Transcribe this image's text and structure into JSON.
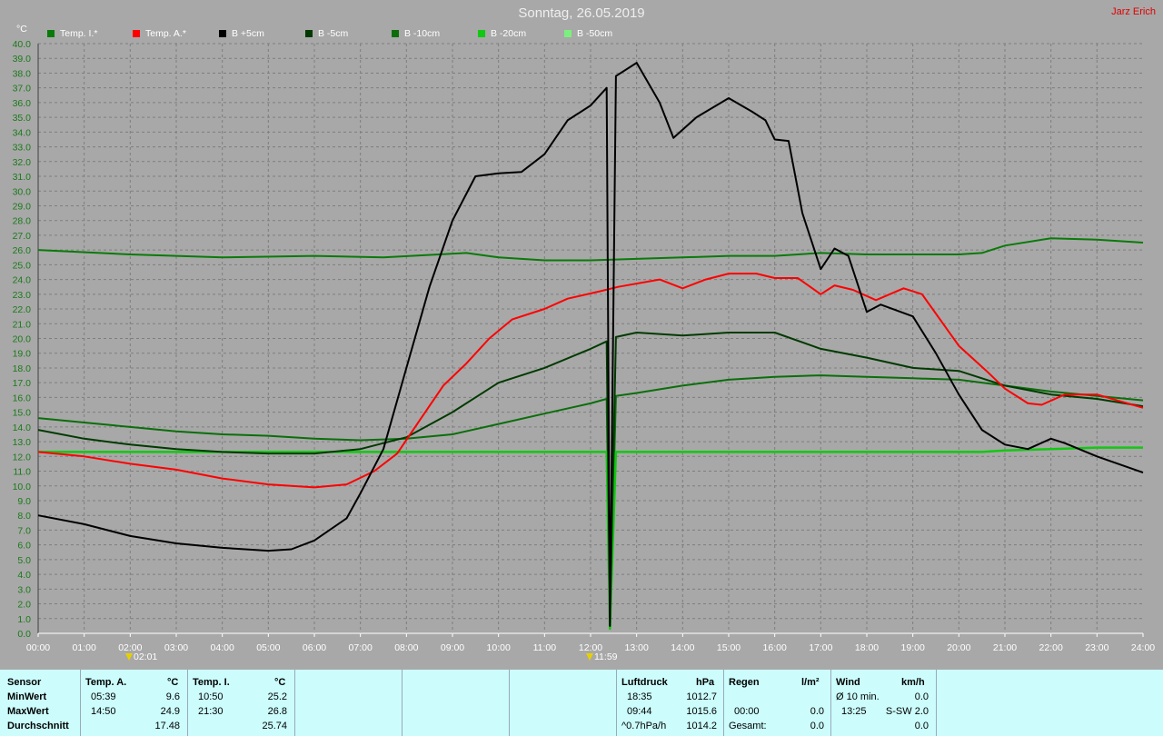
{
  "header": {
    "title": "Sonntag, 26.05.2019",
    "author": "Jarz Erich",
    "unit": "°C"
  },
  "legend": [
    {
      "label": "Temp. I.*",
      "color": "#0a7a0a"
    },
    {
      "label": "Temp. A.*",
      "color": "#ff0000"
    },
    {
      "label": "B +5cm",
      "color": "#000000"
    },
    {
      "label": "B -5cm",
      "color": "#003a00"
    },
    {
      "label": "B -10cm",
      "color": "#0b6e0b"
    },
    {
      "label": "B -20cm",
      "color": "#12c812"
    },
    {
      "label": "B -50cm",
      "color": "#7cf07c"
    }
  ],
  "markers": [
    {
      "label": "02:01",
      "hour": 2.017
    },
    {
      "label": "11:59",
      "hour": 11.983
    }
  ],
  "chart_data": {
    "type": "line",
    "title": "Sonntag, 26.05.2019",
    "ylabel": "°C",
    "ylim": [
      0,
      40
    ],
    "yticks": [
      "0.0",
      "1.0",
      "2.0",
      "3.0",
      "4.0",
      "5.0",
      "6.0",
      "7.0",
      "8.0",
      "9.0",
      "10.0",
      "11.0",
      "12.0",
      "13.0",
      "14.0",
      "15.0",
      "16.0",
      "17.0",
      "18.0",
      "19.0",
      "20.0",
      "21.0",
      "22.0",
      "23.0",
      "24.0",
      "25.0",
      "26.0",
      "27.0",
      "28.0",
      "29.0",
      "30.0",
      "31.0",
      "32.0",
      "33.0",
      "34.0",
      "35.0",
      "36.0",
      "37.0",
      "38.0",
      "39.0",
      "40.0"
    ],
    "xlim": [
      0,
      24
    ],
    "xticks": [
      "00:00",
      "01:00",
      "02:00",
      "03:00",
      "04:00",
      "05:00",
      "06:00",
      "07:00",
      "08:00",
      "09:00",
      "10:00",
      "11:00",
      "12:00",
      "13:00",
      "14:00",
      "15:00",
      "16:00",
      "17:00",
      "18:00",
      "19:00",
      "20:00",
      "21:00",
      "22:00",
      "23:00",
      "24:00"
    ],
    "grid": true,
    "legend_position": "top",
    "series": [
      {
        "name": "Temp. I.*",
        "color": "#0a7a0a",
        "points": [
          [
            0,
            26.0
          ],
          [
            2,
            25.7
          ],
          [
            4,
            25.5
          ],
          [
            6,
            25.6
          ],
          [
            7.5,
            25.5
          ],
          [
            9.3,
            25.8
          ],
          [
            10,
            25.5
          ],
          [
            11,
            25.3
          ],
          [
            12,
            25.3
          ],
          [
            13,
            25.4
          ],
          [
            14,
            25.5
          ],
          [
            15,
            25.6
          ],
          [
            16,
            25.6
          ],
          [
            17,
            25.8
          ],
          [
            18,
            25.7
          ],
          [
            19,
            25.7
          ],
          [
            20,
            25.7
          ],
          [
            20.5,
            25.8
          ],
          [
            21,
            26.3
          ],
          [
            22,
            26.8
          ],
          [
            23,
            26.7
          ],
          [
            24,
            26.5
          ]
        ]
      },
      {
        "name": "Temp. A.*",
        "color": "#ff0000",
        "points": [
          [
            0,
            12.3
          ],
          [
            1,
            12.0
          ],
          [
            2,
            11.5
          ],
          [
            3,
            11.1
          ],
          [
            4,
            10.5
          ],
          [
            5,
            10.1
          ],
          [
            6,
            9.9
          ],
          [
            6.7,
            10.1
          ],
          [
            7.3,
            11.0
          ],
          [
            7.8,
            12.2
          ],
          [
            8.3,
            14.5
          ],
          [
            8.8,
            16.8
          ],
          [
            9.3,
            18.3
          ],
          [
            9.8,
            20.0
          ],
          [
            10.3,
            21.3
          ],
          [
            11,
            22.0
          ],
          [
            11.5,
            22.7
          ],
          [
            12.2,
            23.2
          ],
          [
            12.6,
            23.5
          ],
          [
            13.5,
            24.0
          ],
          [
            14,
            23.4
          ],
          [
            14.5,
            24.0
          ],
          [
            15,
            24.4
          ],
          [
            15.6,
            24.4
          ],
          [
            16,
            24.1
          ],
          [
            16.5,
            24.1
          ],
          [
            17,
            23.0
          ],
          [
            17.3,
            23.6
          ],
          [
            17.7,
            23.3
          ],
          [
            18.2,
            22.6
          ],
          [
            18.8,
            23.4
          ],
          [
            19.2,
            23.0
          ],
          [
            20,
            19.5
          ],
          [
            20.6,
            17.8
          ],
          [
            21,
            16.6
          ],
          [
            21.5,
            15.6
          ],
          [
            21.8,
            15.5
          ],
          [
            22.3,
            16.2
          ],
          [
            23,
            16.2
          ],
          [
            24,
            15.3
          ]
        ]
      },
      {
        "name": "B +5cm",
        "color": "#000000",
        "points": [
          [
            0,
            8.0
          ],
          [
            1,
            7.4
          ],
          [
            2,
            6.6
          ],
          [
            3,
            6.1
          ],
          [
            4,
            5.8
          ],
          [
            5,
            5.6
          ],
          [
            5.5,
            5.7
          ],
          [
            6,
            6.3
          ],
          [
            6.7,
            7.8
          ],
          [
            7,
            9.5
          ],
          [
            7.5,
            12.5
          ],
          [
            8,
            18.0
          ],
          [
            8.5,
            23.5
          ],
          [
            9,
            28.0
          ],
          [
            9.5,
            31.0
          ],
          [
            10,
            31.2
          ],
          [
            10.5,
            31.3
          ],
          [
            11,
            32.5
          ],
          [
            11.5,
            34.8
          ],
          [
            12,
            35.8
          ],
          [
            12.35,
            37.0
          ],
          [
            12.42,
            0.5
          ],
          [
            12.55,
            37.8
          ],
          [
            13,
            38.7
          ],
          [
            13.5,
            36.0
          ],
          [
            13.8,
            33.6
          ],
          [
            14.3,
            35.0
          ],
          [
            15,
            36.3
          ],
          [
            15.5,
            35.4
          ],
          [
            15.8,
            34.8
          ],
          [
            16,
            33.5
          ],
          [
            16.3,
            33.4
          ],
          [
            16.6,
            28.5
          ],
          [
            17,
            24.7
          ],
          [
            17.3,
            26.1
          ],
          [
            17.6,
            25.6
          ],
          [
            18,
            21.8
          ],
          [
            18.3,
            22.3
          ],
          [
            19,
            21.5
          ],
          [
            19.5,
            19.0
          ],
          [
            20,
            16.2
          ],
          [
            20.5,
            13.8
          ],
          [
            21,
            12.8
          ],
          [
            21.5,
            12.5
          ],
          [
            22,
            13.2
          ],
          [
            22.3,
            12.9
          ],
          [
            23,
            12.0
          ],
          [
            24,
            10.9
          ]
        ]
      },
      {
        "name": "B -5cm",
        "color": "#003a00",
        "points": [
          [
            0,
            13.8
          ],
          [
            1,
            13.2
          ],
          [
            2,
            12.8
          ],
          [
            3,
            12.5
          ],
          [
            4,
            12.3
          ],
          [
            5,
            12.2
          ],
          [
            6,
            12.2
          ],
          [
            7,
            12.5
          ],
          [
            8,
            13.3
          ],
          [
            9,
            15.0
          ],
          [
            10,
            17.0
          ],
          [
            11,
            18.0
          ],
          [
            12,
            19.3
          ],
          [
            12.35,
            19.8
          ],
          [
            12.42,
            1.0
          ],
          [
            12.55,
            20.1
          ],
          [
            13,
            20.4
          ],
          [
            14,
            20.2
          ],
          [
            15,
            20.4
          ],
          [
            16,
            20.4
          ],
          [
            17,
            19.3
          ],
          [
            18,
            18.7
          ],
          [
            19,
            18.0
          ],
          [
            20,
            17.8
          ],
          [
            21,
            16.8
          ],
          [
            22,
            16.2
          ],
          [
            23,
            15.9
          ],
          [
            24,
            15.4
          ]
        ]
      },
      {
        "name": "B -10cm",
        "color": "#0b6e0b",
        "points": [
          [
            0,
            14.6
          ],
          [
            1,
            14.3
          ],
          [
            2,
            14.0
          ],
          [
            3,
            13.7
          ],
          [
            4,
            13.5
          ],
          [
            5,
            13.4
          ],
          [
            6,
            13.2
          ],
          [
            7,
            13.1
          ],
          [
            8,
            13.2
          ],
          [
            9,
            13.5
          ],
          [
            10,
            14.2
          ],
          [
            11,
            14.9
          ],
          [
            12,
            15.6
          ],
          [
            12.35,
            15.9
          ],
          [
            12.42,
            0.8
          ],
          [
            12.55,
            16.1
          ],
          [
            13,
            16.3
          ],
          [
            14,
            16.8
          ],
          [
            15,
            17.2
          ],
          [
            16,
            17.4
          ],
          [
            17,
            17.5
          ],
          [
            18,
            17.4
          ],
          [
            19,
            17.3
          ],
          [
            20,
            17.2
          ],
          [
            21,
            16.8
          ],
          [
            22,
            16.4
          ],
          [
            23,
            16.1
          ],
          [
            24,
            15.8
          ]
        ]
      },
      {
        "name": "B -20cm",
        "color": "#12c812",
        "points": [
          [
            0,
            12.3
          ],
          [
            6,
            12.3
          ],
          [
            10,
            12.3
          ],
          [
            12.35,
            12.3
          ],
          [
            12.42,
            0.3
          ],
          [
            12.55,
            12.3
          ],
          [
            15,
            12.3
          ],
          [
            18,
            12.3
          ],
          [
            20.5,
            12.3
          ],
          [
            21,
            12.4
          ],
          [
            22,
            12.5
          ],
          [
            23,
            12.6
          ],
          [
            24,
            12.6
          ]
        ]
      },
      {
        "name": "B -50cm",
        "color": "#7cf07c",
        "points": []
      }
    ]
  },
  "stats": {
    "sensor": {
      "header": "Sensor",
      "rows": [
        "MinWert",
        "MaxWert",
        "Durchschnitt"
      ]
    },
    "temp_a": {
      "header": "Temp. A.",
      "unit": "°C",
      "rows": [
        {
          "time": "05:39",
          "value": "9.6"
        },
        {
          "time": "14:50",
          "value": "24.9"
        },
        {
          "time": "",
          "value": "17.48"
        }
      ]
    },
    "temp_i": {
      "header": "Temp. I.",
      "unit": "°C",
      "rows": [
        {
          "time": "10:50",
          "value": "25.2"
        },
        {
          "time": "21:30",
          "value": "26.8"
        },
        {
          "time": "",
          "value": "25.74"
        }
      ]
    },
    "pressure": {
      "header": "Luftdruck",
      "unit": "hPa",
      "rows": [
        {
          "time": "18:35",
          "value": "1012.7"
        },
        {
          "time": "09:44",
          "value": "1015.6"
        },
        {
          "time": "^0.7hPa/h",
          "value": "1014.2"
        }
      ]
    },
    "rain": {
      "header": "Regen",
      "unit": "l/m²",
      "rows": [
        {
          "time": "",
          "value": ""
        },
        {
          "time": "00:00",
          "value": "0.0"
        },
        {
          "time": "Gesamt:",
          "value": "0.0"
        }
      ]
    },
    "wind": {
      "header": "Wind",
      "unit": "km/h",
      "rows": [
        {
          "time": "Ø 10 min.",
          "value": "0.0"
        },
        {
          "time": "13:25",
          "value": "S-SW 2.0"
        },
        {
          "time": "",
          "value": "0.0"
        }
      ]
    }
  }
}
